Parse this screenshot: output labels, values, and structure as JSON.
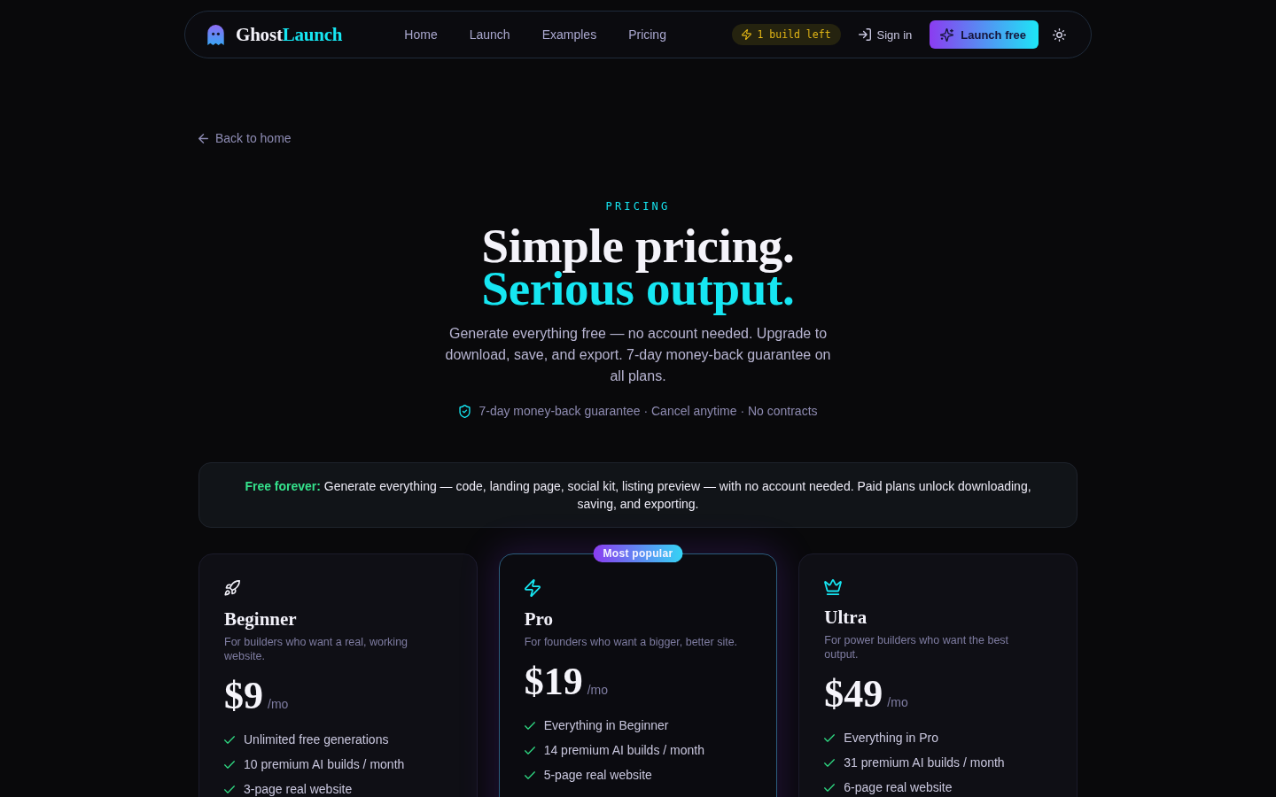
{
  "nav": {
    "logo": {
      "part_1": "Ghost",
      "part_2": "Launch"
    },
    "links": [
      "Home",
      "Launch",
      "Examples",
      "Pricing"
    ],
    "credits": "1 build left",
    "sign_in": "Sign in",
    "cta": "Launch free"
  },
  "back_link": "Back to home",
  "hero": {
    "eyebrow": "PRICING",
    "title_line_1": "Simple pricing.",
    "title_line_2": "Serious output.",
    "subtitle": "Generate everything free — no account needed. Upgrade to download, save, and export. 7-day money-back guarantee on all plans.",
    "guarantee": "7-day money-back guarantee · Cancel anytime · No contracts"
  },
  "notice": "**Free forever:** Generate everything — code, landing page, social kit, listing preview — with no account needed. Paid plans unlock downloading, saving, and exporting.",
  "plans": [
    {
      "kind": "basic",
      "featured": false,
      "name": "Beginner",
      "description": "For builders who want a real, working website.",
      "price": "$9",
      "period": "/mo",
      "features": [
        "Unlimited free generations",
        "10 premium AI builds / month",
        "3-page real website"
      ]
    },
    {
      "kind": "pro",
      "featured": true,
      "badge": "Most popular",
      "name": "Pro",
      "description": "For founders who want a bigger, better site.",
      "price": "$19",
      "period": "/mo",
      "features": [
        "Everything in Beginner",
        "14 premium AI builds / month",
        "5-page real website"
      ]
    },
    {
      "kind": "ultra",
      "featured": false,
      "name": "Ultra",
      "description": "For power builders who want the best output.",
      "price": "$49",
      "period": "/mo",
      "features": [
        "Everything in Pro",
        "31 premium AI builds / month",
        "6-page real website"
      ]
    }
  ]
}
